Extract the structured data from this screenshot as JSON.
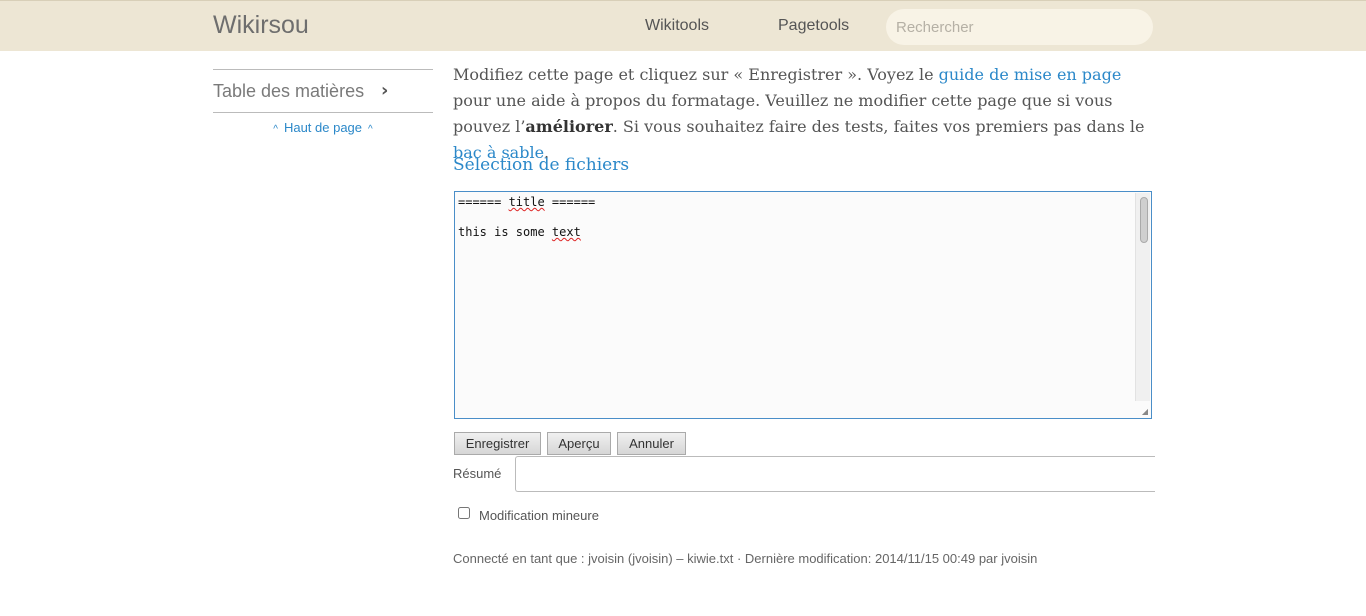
{
  "header": {
    "site_title": "Wikirsou",
    "nav": {
      "wikitools": "Wikitools",
      "pagetools": "Pagetools"
    },
    "search": {
      "placeholder": "Rechercher",
      "value": ""
    }
  },
  "sidebar": {
    "toc_label": "Table des matières",
    "back_to_top": "Haut de page"
  },
  "intro": {
    "part1": "Modifiez cette page et cliquez sur « Enregistrer ». Voyez le ",
    "link_guide": "guide de mise en page",
    "part2": " pour une aide à propos du formatage. Veuillez ne modifier cette page que si vous pouvez l’",
    "bold": "améliorer",
    "part3": ". Si vous souhaitez faire des tests, faites vos premiers pas dans le ",
    "link_sandbox": "bac à sable",
    "part4": "."
  },
  "section_title": "Sélection de fichiers",
  "editor": {
    "line1_prefix": "====== ",
    "line1_word": "title",
    "line1_suffix": " ======",
    "line2_prefix": "this is some ",
    "line2_word": "text"
  },
  "buttons": {
    "save": "Enregistrer",
    "preview": "Aperçu",
    "cancel": "Annuler"
  },
  "summary": {
    "label": "Résumé",
    "value": ""
  },
  "minor_edit": {
    "label": "Modification mineure",
    "checked": false
  },
  "footer": "Connecté en tant que : jvoisin (jvoisin) – kiwie.txt · Dernière modification: 2014/11/15 00:49 par jvoisin"
}
